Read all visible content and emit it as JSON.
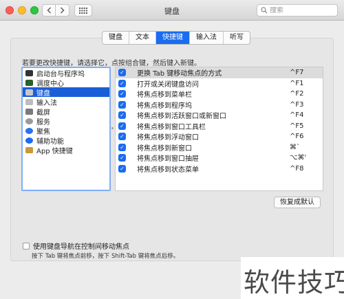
{
  "window": {
    "title": "键盘"
  },
  "search": {
    "placeholder": "搜索",
    "icon": "search-icon"
  },
  "tabs": [
    {
      "label": "键盘",
      "active": false
    },
    {
      "label": "文本",
      "active": false
    },
    {
      "label": "快捷键",
      "active": true
    },
    {
      "label": "输入法",
      "active": false
    },
    {
      "label": "听写",
      "active": false
    }
  ],
  "hint": "若要更改快捷键，请选择它，点按组合键，然后键入新键。",
  "categories": [
    {
      "label": "启动台与程序坞",
      "icon": "launchpad-dock-icon",
      "color": "#333333",
      "selected": false
    },
    {
      "label": "调度中心",
      "icon": "mission-control-icon",
      "color": "#2b5f2b",
      "selected": false
    },
    {
      "label": "键盘",
      "icon": "keyboard-icon",
      "color": "#c8c8c8",
      "selected": true
    },
    {
      "label": "输入法",
      "icon": "input-sources-icon",
      "color": "#bdbdbd",
      "selected": false
    },
    {
      "label": "截屏",
      "icon": "screenshot-icon",
      "color": "#7a7a7a",
      "selected": false
    },
    {
      "label": "服务",
      "icon": "services-gear-icon",
      "color": "#9a9a9a",
      "selected": false
    },
    {
      "label": "聚焦",
      "icon": "spotlight-icon",
      "color": "#2a73e8",
      "selected": false
    },
    {
      "label": "辅助功能",
      "icon": "accessibility-icon",
      "color": "#1a6cf0",
      "selected": false
    },
    {
      "label": "App 快捷键",
      "icon": "app-shortcuts-icon",
      "color": "#c99a3a",
      "selected": false
    }
  ],
  "shortcuts": [
    {
      "label": "更换 Tab 键移动焦点的方式",
      "key": "^F7",
      "checked": true,
      "selected": true
    },
    {
      "label": "打开或关闭键盘访问",
      "key": "^F1",
      "checked": true,
      "selected": false
    },
    {
      "label": "将焦点移到菜单栏",
      "key": "^F2",
      "checked": true,
      "selected": false
    },
    {
      "label": "将焦点移到程序坞",
      "key": "^F3",
      "checked": true,
      "selected": false
    },
    {
      "label": "将焦点移到活跃窗口或新窗口",
      "key": "^F4",
      "checked": true,
      "selected": false
    },
    {
      "label": "将焦点移到窗口工具栏",
      "key": "^F5",
      "checked": true,
      "selected": false
    },
    {
      "label": "将焦点移到浮动窗口",
      "key": "^F6",
      "checked": true,
      "selected": false
    },
    {
      "label": "将焦点移到新窗口",
      "key": "⌘`",
      "checked": true,
      "selected": false
    },
    {
      "label": "将焦点移到窗口抽屉",
      "key": "⌥⌘'",
      "checked": true,
      "selected": false
    },
    {
      "label": "将焦点移到状态菜单",
      "key": "^F8",
      "checked": true,
      "selected": false
    }
  ],
  "restore_button": "恢复成默认",
  "bottom_checkbox": {
    "label": "使用键盘导航在控制间移动焦点",
    "checked": false
  },
  "bottom_note": "按下 Tab 键将焦点前移，按下 Shift-Tab 键将焦点后移。",
  "watermark": "软件技巧",
  "colors": {
    "accent": "#1a6cf0",
    "selection": "#1a5fd8"
  }
}
